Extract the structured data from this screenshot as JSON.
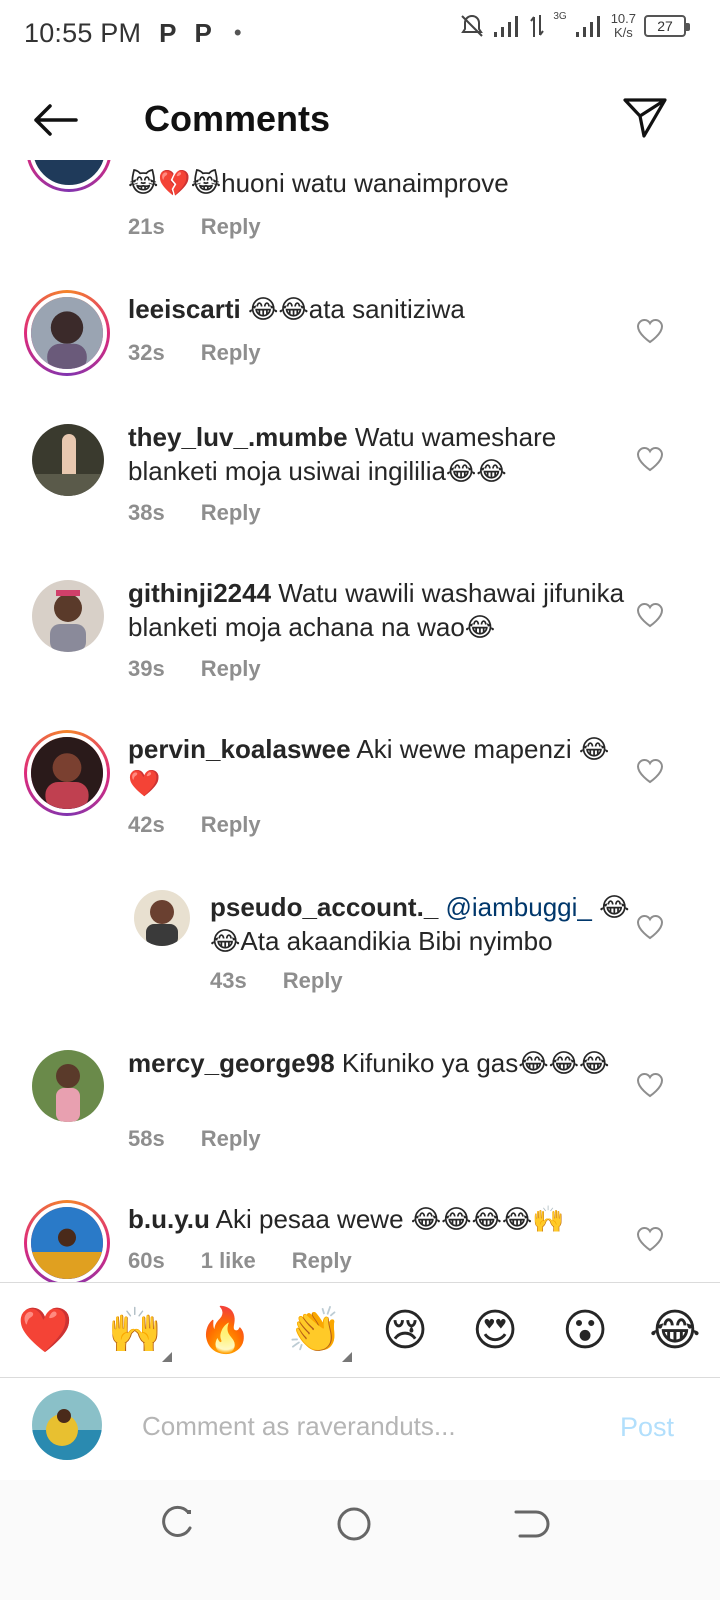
{
  "status_bar": {
    "time": "10:55 PM",
    "notif1": "P",
    "notif2": "P",
    "dot": "•",
    "net_type": "3G",
    "speed_value": "10.7",
    "speed_unit": "K/s",
    "battery": "27"
  },
  "header": {
    "title": "Comments",
    "back_icon": "arrow-left-icon",
    "share_icon": "paper-plane-icon"
  },
  "comments": [
    {
      "username": "",
      "text": "😹💔😹huoni watu wanaimprove",
      "time": "21s",
      "reply": "Reply",
      "likes": ""
    },
    {
      "username": "leeiscarti",
      "text": " 😂😂ata sanitiziwa",
      "time": "32s",
      "reply": "Reply",
      "likes": ""
    },
    {
      "username": "they_luv_.mumbe",
      "text": " Watu wameshare blanketi moja usiwai ingililia😂😂",
      "time": "38s",
      "reply": "Reply",
      "likes": ""
    },
    {
      "username": "githinji2244",
      "text": " Watu wawili washawai jifunika blanketi moja achana na wao😂",
      "time": "39s",
      "reply": "Reply",
      "likes": ""
    },
    {
      "username": "pervin_koalaswee",
      "text": " Aki wewe mapenzi 😂❤️",
      "time": "42s",
      "reply": "Reply",
      "likes": ""
    },
    {
      "username": "pseudo_account._",
      "mention": " @iambuggi_",
      "text": " 😂😂Ata akaandikia Bibi nyimbo",
      "time": "43s",
      "reply": "Reply",
      "likes": ""
    },
    {
      "username": "mercy_george98",
      "text": " Kifuniko ya gas😂😂😂",
      "time": "58s",
      "reply": "Reply",
      "likes": ""
    },
    {
      "username": "b.u.y.u",
      "text": " Aki pesaa wewe 😂😂😂😂🙌",
      "time": "60s",
      "reply": "Reply",
      "likes": "1 like"
    }
  ],
  "emoji_bar": [
    "❤️",
    "🙌",
    "🔥",
    "👏",
    "😢",
    "😍",
    "😮",
    "😂"
  ],
  "input": {
    "placeholder": "Comment as raveranduts...",
    "post_label": "Post"
  },
  "colors": {
    "accent_post": "#b2dffc",
    "meta_gray": "#8e8e8e",
    "mention_blue": "#00376b",
    "story_ring_start": "#f58529",
    "story_ring_end": "#dd2a7b"
  }
}
